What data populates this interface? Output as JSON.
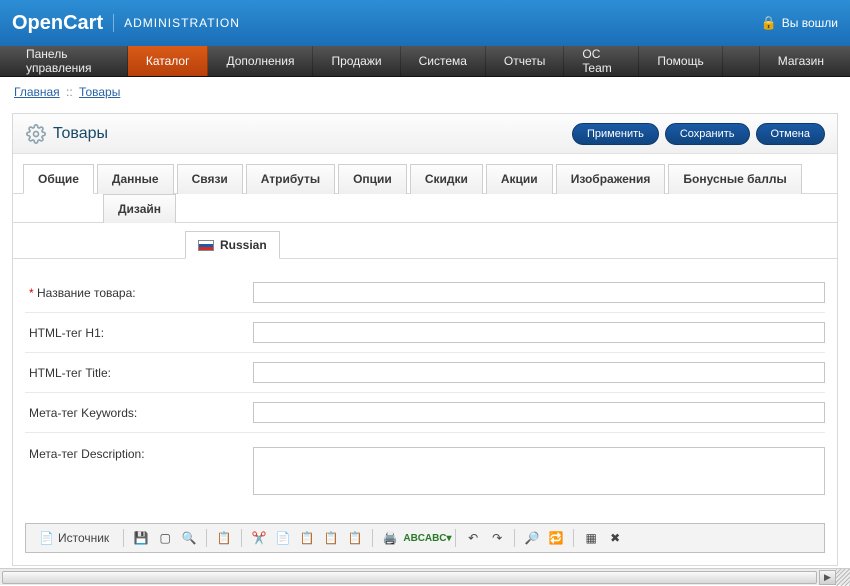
{
  "header": {
    "brand": "OpenCart",
    "section": "ADMINISTRATION",
    "login_status": "Вы вошли"
  },
  "menu": {
    "items": [
      "Панель управления",
      "Каталог",
      "Дополнения",
      "Продажи",
      "Система",
      "Отчеты",
      "OC Team",
      "Помощь"
    ],
    "active_index": 1,
    "right": "Магазин"
  },
  "breadcrumb": {
    "home": "Главная",
    "current": "Товары"
  },
  "page": {
    "title": "Товары",
    "buttons": {
      "apply": "Применить",
      "save": "Сохранить",
      "cancel": "Отмена"
    }
  },
  "tabs": {
    "row1": [
      "Общие",
      "Данные",
      "Связи",
      "Атрибуты",
      "Опции",
      "Скидки",
      "Акции",
      "Изображения",
      "Бонусные баллы"
    ],
    "row2": [
      "Дизайн"
    ],
    "active_row1": 0,
    "lang": "Russian"
  },
  "form": {
    "name_label": "Название товара:",
    "name_value": "",
    "h1_label": "HTML-тег H1:",
    "h1_value": "",
    "title_label": "HTML-тег Title:",
    "title_value": "",
    "meta_kw_label": "Мета-тег Keywords:",
    "meta_kw_value": "",
    "meta_desc_label": "Мета-тег Description:",
    "meta_desc_value": ""
  },
  "editor": {
    "source": "Источник"
  }
}
